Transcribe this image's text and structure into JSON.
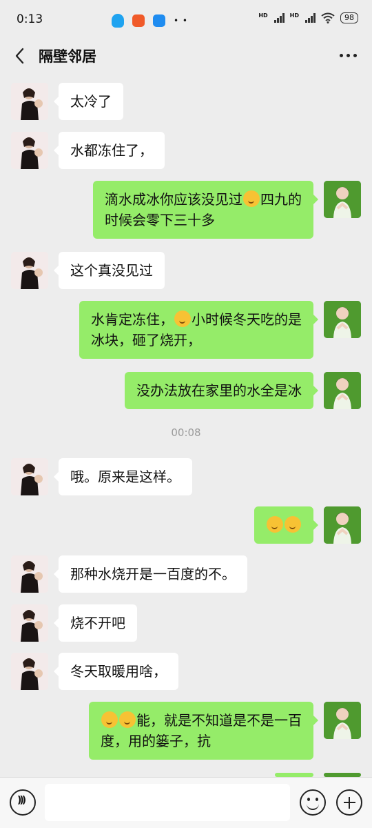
{
  "status_bar": {
    "time": "0:13",
    "hd_label": "HD",
    "battery": "98"
  },
  "nav": {
    "title": "隔壁邻居"
  },
  "messages": [
    {
      "side": "left",
      "text": "太冷了"
    },
    {
      "side": "left",
      "text": "水都冻住了，"
    },
    {
      "side": "right",
      "line1_a": "滴水成冰你应该没见过",
      "line1_b": "四九的",
      "line2": "时候会零下三十多"
    },
    {
      "side": "left",
      "text": "这个真没见过"
    },
    {
      "side": "right",
      "line1_a": "水肯定冻住，",
      "line1_b": "小时候冬天吃的是",
      "line2": "冰块，砸了烧开，"
    },
    {
      "side": "right",
      "text": "没办法放在家里的水全是冰"
    },
    {
      "side": "left",
      "text": "哦。原来是这样。"
    },
    {
      "side": "right",
      "emoji_count": 2
    },
    {
      "side": "left",
      "text": "那种水烧开是一百度的不。"
    },
    {
      "side": "left",
      "text": "烧不开吧"
    },
    {
      "side": "left",
      "text": "冬天取暖用啥，"
    },
    {
      "side": "right",
      "line1_b": "能，就是不知道是不是一百",
      "line2": "度，用的篓子，抗"
    }
  ],
  "timestamp": "00:08",
  "colors": {
    "background": "#ededed",
    "bubble_self": "#95ec69",
    "bubble_other": "#ffffff"
  }
}
